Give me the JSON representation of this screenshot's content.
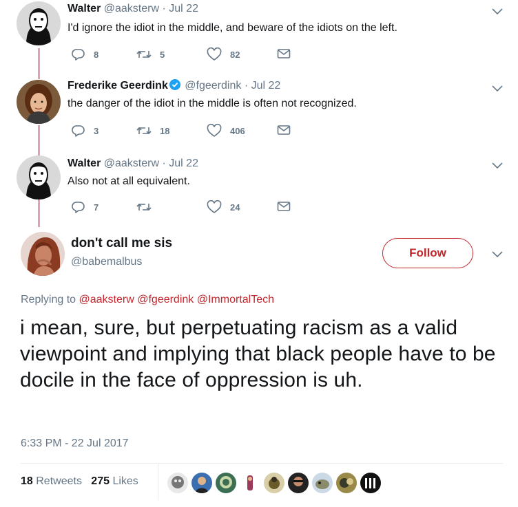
{
  "thread": [
    {
      "name": "Walter",
      "handle": "@aaksterw",
      "separator": "·",
      "date": "Jul 22",
      "text": "I'd ignore the idiot in the middle, and beware of the idiots on the left.",
      "replies": "8",
      "retweets": "5",
      "likes": "82"
    },
    {
      "name": "Frederike Geerdink",
      "handle": "@fgeerdink",
      "separator": "·",
      "date": "Jul 22",
      "text": "the danger of the idiot in the middle is often not recognized.",
      "replies": "3",
      "retweets": "18",
      "likes": "406"
    },
    {
      "name": "Walter",
      "handle": "@aaksterw",
      "separator": "·",
      "date": "Jul 22",
      "text": "Also not at all equivalent.",
      "replies": "7",
      "retweets": "",
      "likes": "24"
    }
  ],
  "main": {
    "name": "don't call me sis",
    "handle": "@babemalbus",
    "follow_label": "Follow",
    "replying_prefix": "Replying to",
    "mentions": [
      "@aaksterw",
      "@fgeerdink",
      "@ImmortalTech"
    ],
    "text": "i mean, sure, but perpetuating racism as a valid viewpoint and implying that black people have to be docile in the face of oppression is uh.",
    "timestamp": "6:33 PM - 22 Jul 2017",
    "retweets_count": "18",
    "retweets_label": "Retweets",
    "likes_count": "275",
    "likes_label": "Likes"
  },
  "colors": {
    "accent": "#c1272d",
    "thread_line": "#e2a2b4",
    "muted": "#657786",
    "verified": "#1da1f2"
  },
  "icons": [
    "reply-icon",
    "retweet-icon",
    "heart-icon",
    "message-icon",
    "chevron-down-icon",
    "verified-badge-icon"
  ]
}
